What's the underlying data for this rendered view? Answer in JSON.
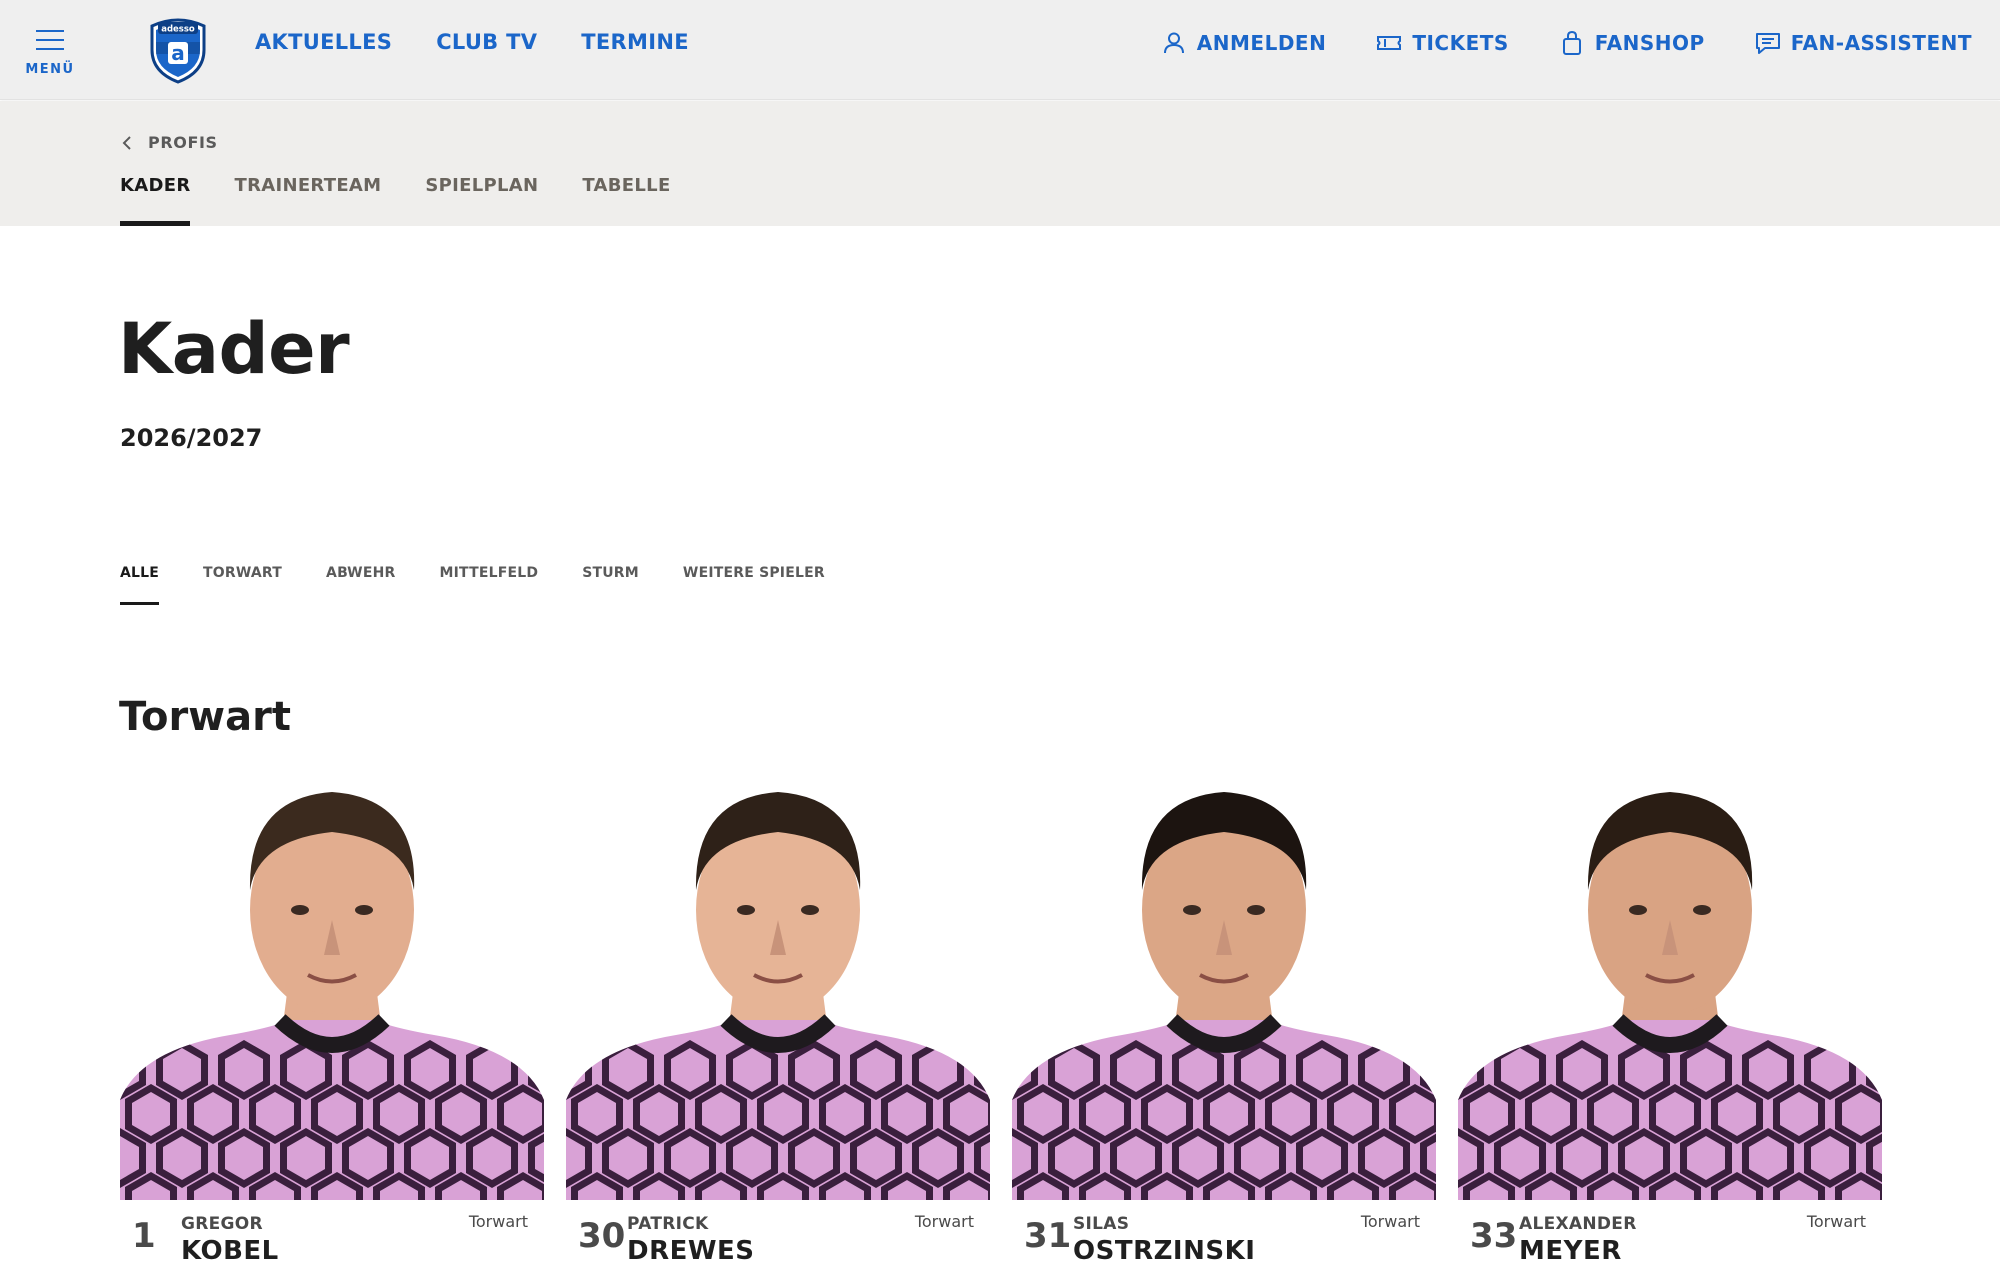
{
  "header": {
    "menu_label": "MENÜ",
    "logo_text": "adesso",
    "nav": [
      "AKTUELLES",
      "CLUB TV",
      "TERMINE"
    ],
    "utility": [
      {
        "label": "ANMELDEN",
        "icon": "user-icon"
      },
      {
        "label": "TICKETS",
        "icon": "ticket-icon"
      },
      {
        "label": "FANSHOP",
        "icon": "shopping-bag-icon"
      },
      {
        "label": "FAN-ASSISTENT",
        "icon": "chat-icon"
      }
    ]
  },
  "subnav": {
    "back_label": "PROFIS",
    "tabs": [
      "KADER",
      "TRAINERTEAM",
      "SPIELPLAN",
      "TABELLE"
    ],
    "active_tab": "KADER"
  },
  "main": {
    "title": "Kader",
    "season": "2026/2027",
    "filters": [
      "ALLE",
      "TORWART",
      "ABWEHR",
      "MITTELFELD",
      "STURM",
      "WEITERE SPIELER"
    ],
    "active_filter": "ALLE",
    "section_title": "Torwart"
  },
  "players": [
    {
      "number": "1",
      "first_name": "GREGOR",
      "last_name": "KOBEL",
      "position": "Torwart"
    },
    {
      "number": "30",
      "first_name": "PATRICK",
      "last_name": "DREWES",
      "position": "Torwart"
    },
    {
      "number": "31",
      "first_name": "SILAS",
      "last_name": "OSTRZINSKI",
      "position": "Torwart"
    },
    {
      "number": "33",
      "first_name": "ALEXANDER",
      "last_name": "MEYER",
      "position": "Torwart"
    }
  ],
  "colors": {
    "accent": "#1b66c9",
    "header_bg": "#efefef",
    "subnav_bg": "#efeeec",
    "jersey_pink": "#d9a2d6",
    "jersey_pattern": "#3a1f3d"
  }
}
